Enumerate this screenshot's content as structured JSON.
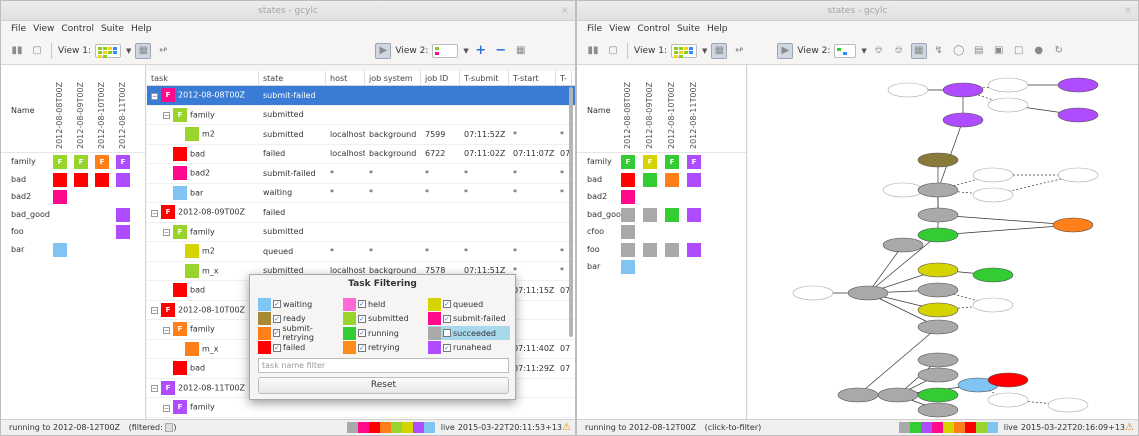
{
  "colors": {
    "waiting": "#7fc4f2",
    "held": "#ff6ad5",
    "queued": "#d6d400",
    "ready": "#a88a33",
    "submitted": "#99d42c",
    "submit_failed": "#ff0a8c",
    "submit_retrying": "#ff7f1a",
    "running": "#33cc33",
    "succeeded": "#a9a9a9",
    "failed": "#ff0000",
    "retrying": "#ff8c1a",
    "runahead": "#b04cff",
    "selection": "#3a7bd5"
  },
  "left": {
    "title": "states - gcylc",
    "close": "×",
    "menu": [
      "File",
      "View",
      "Control",
      "Suite",
      "Help"
    ],
    "view1_label": "View 1:",
    "view2_label": "View 2:",
    "matrix": {
      "name_header": "Name",
      "cycles": [
        "2012-08-08T00Z",
        "2012-08-09T00Z",
        "2012-08-10T00Z",
        "2012-08-11T00Z"
      ],
      "rows": [
        {
          "name": "family",
          "cells": [
            "F",
            "F",
            "F",
            "F"
          ]
        },
        {
          "name": "bad",
          "cells": [
            "",
            "",
            "",
            ""
          ]
        },
        {
          "name": "bad2",
          "cells": [
            ""
          ]
        },
        {
          "name": "bad_good",
          "cells": [
            ""
          ]
        },
        {
          "name": "foo",
          "cells": [
            ""
          ]
        },
        {
          "name": "bar",
          "cells": [
            ""
          ]
        }
      ]
    },
    "tree": {
      "columns": [
        "task",
        "state",
        "host",
        "job system",
        "job ID",
        "T-submit",
        "T-start",
        "T-"
      ],
      "rows": [
        {
          "task": "2012-08-08T00Z",
          "state": "submit-failed",
          "host": "",
          "sys": "",
          "id": "",
          "tsub": "",
          "tstart": "",
          "tend": ""
        },
        {
          "task": "family",
          "state": "submitted",
          "host": "",
          "sys": "",
          "id": "",
          "tsub": "",
          "tstart": "",
          "tend": ""
        },
        {
          "task": "m2",
          "state": "submitted",
          "host": "localhost",
          "sys": "background",
          "id": "7599",
          "tsub": "07:11:52Z",
          "tstart": "*",
          "tend": "*"
        },
        {
          "task": "bad",
          "state": "failed",
          "host": "localhost",
          "sys": "background",
          "id": "6722",
          "tsub": "07:11:02Z",
          "tstart": "07:11:07Z",
          "tend": "07"
        },
        {
          "task": "bad2",
          "state": "submit-failed",
          "host": "*",
          "sys": "*",
          "id": "*",
          "tsub": "*",
          "tstart": "*",
          "tend": "*"
        },
        {
          "task": "bar",
          "state": "waiting",
          "host": "*",
          "sys": "*",
          "id": "*",
          "tsub": "*",
          "tstart": "*",
          "tend": "*"
        },
        {
          "task": "2012-08-09T00Z",
          "state": "failed",
          "host": "",
          "sys": "",
          "id": "",
          "tsub": "",
          "tstart": "",
          "tend": ""
        },
        {
          "task": "family",
          "state": "submitted",
          "host": "",
          "sys": "",
          "id": "",
          "tsub": "",
          "tstart": "",
          "tend": ""
        },
        {
          "task": "m2",
          "state": "queued",
          "host": "*",
          "sys": "*",
          "id": "*",
          "tsub": "*",
          "tstart": "*",
          "tend": "*"
        },
        {
          "task": "m_x",
          "state": "submitted",
          "host": "localhost",
          "sys": "background",
          "id": "7578",
          "tsub": "07:11:51Z",
          "tstart": "*",
          "tend": "*"
        },
        {
          "task": "bad",
          "state": "failed",
          "host": "localhost",
          "sys": "background",
          "id": "6882",
          "tsub": "07:11:10Z",
          "tstart": "07:11:15Z",
          "tend": "07"
        },
        {
          "task": "2012-08-10T00Z",
          "state": "",
          "host": "",
          "sys": "",
          "id": "",
          "tsub": "",
          "tstart": "",
          "tend": ""
        },
        {
          "task": "family",
          "state": "",
          "host": "",
          "sys": "",
          "id": "",
          "tsub": "",
          "tstart": "",
          "tend": ""
        },
        {
          "task": "m_x",
          "state": "",
          "host": "",
          "sys": "",
          "id": "",
          "tsub": "",
          "tstart": "07:11:40Z",
          "tend": "07"
        },
        {
          "task": "bad",
          "state": "",
          "host": "",
          "sys": "",
          "id": "",
          "tsub": "",
          "tstart": "07:11:29Z",
          "tend": "07"
        },
        {
          "task": "2012-08-11T00Z",
          "state": "",
          "host": "",
          "sys": "",
          "id": "",
          "tsub": "",
          "tstart": "",
          "tend": ""
        },
        {
          "task": "family",
          "state": "",
          "host": "",
          "sys": "",
          "id": "",
          "tsub": "",
          "tstart": "",
          "tend": ""
        },
        {
          "task": "m1",
          "state": "",
          "host": "",
          "sys": "",
          "id": "",
          "tsub": "",
          "tstart": "",
          "tend": ""
        },
        {
          "task": "m3",
          "state": "runahead",
          "host": "*",
          "sys": "*",
          "id": "*",
          "tsub": "*",
          "tstart": "*",
          "tend": "*"
        }
      ]
    },
    "dialog": {
      "title": "Task Filtering",
      "items": [
        {
          "label": "waiting",
          "checked": true
        },
        {
          "label": "held",
          "checked": true
        },
        {
          "label": "queued",
          "checked": true
        },
        {
          "label": "ready",
          "checked": true
        },
        {
          "label": "submitted",
          "checked": true
        },
        {
          "label": "submit-failed",
          "checked": true
        },
        {
          "label": "submit-retrying",
          "checked": true
        },
        {
          "label": "running",
          "checked": true
        },
        {
          "label": "succeeded",
          "checked": false
        },
        {
          "label": "failed",
          "checked": true
        },
        {
          "label": "retrying",
          "checked": true
        },
        {
          "label": "runahead",
          "checked": true
        }
      ],
      "filter_placeholder": "task name filter",
      "reset_label": "Reset"
    },
    "status": {
      "text": "running to 2012-08-12T00Z",
      "filtered": "(filtered:",
      "live": "live",
      "time": "2015-03-22T20:11:53+13"
    }
  },
  "right": {
    "title": "states - gcylc",
    "close": "×",
    "menu": [
      "File",
      "View",
      "Control",
      "Suite",
      "Help"
    ],
    "view1_label": "View 1:",
    "view2_label": "View 2:",
    "matrix": {
      "name_header": "Name",
      "cycles": [
        "2012-08-08T00Z",
        "2012-08-09T00Z",
        "2012-08-10T00Z",
        "2012-08-11T00Z"
      ],
      "rows": [
        {
          "name": "family",
          "cells": [
            "F",
            "F",
            "F",
            "F"
          ]
        },
        {
          "name": "bad",
          "cells": [
            "",
            "",
            "",
            ""
          ]
        },
        {
          "name": "bad2",
          "cells": [
            ""
          ]
        },
        {
          "name": "bad_good",
          "cells": [
            "",
            "",
            "",
            ""
          ]
        },
        {
          "name": "cfoo",
          "cells": [
            ""
          ]
        },
        {
          "name": "foo",
          "cells": [
            "",
            "",
            "",
            ""
          ]
        },
        {
          "name": "bar",
          "cells": [
            ""
          ]
        }
      ]
    },
    "status": {
      "text": "running to 2012-08-12T00Z",
      "hint": "(click-to-filter)",
      "live": "live",
      "time": "2015-03-22T20:16:09+13"
    }
  }
}
